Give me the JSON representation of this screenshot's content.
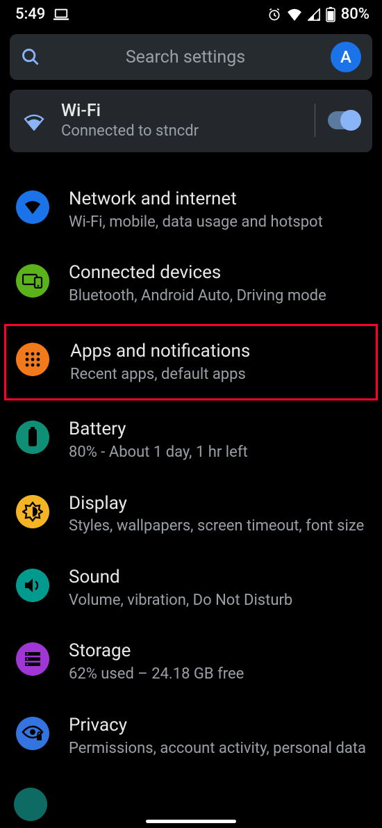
{
  "status": {
    "time": "5:49",
    "battery_pct": "80%"
  },
  "search": {
    "placeholder": "Search settings",
    "avatar_initial": "A"
  },
  "wifi_card": {
    "title": "Wi-Fi",
    "subtitle": "Connected to stncdr",
    "enabled": true
  },
  "items": [
    {
      "title": "Network and internet",
      "subtitle": "Wi-Fi, mobile, data usage and hotspot",
      "icon": "wifi-icon",
      "color": "c-blue"
    },
    {
      "title": "Connected devices",
      "subtitle": "Bluetooth, Android Auto, Driving mode",
      "icon": "devices-icon",
      "color": "c-green"
    },
    {
      "title": "Apps and notifications",
      "subtitle": "Recent apps, default apps",
      "icon": "apps-icon",
      "color": "c-orange",
      "highlight": true
    },
    {
      "title": "Battery",
      "subtitle": "80% - About 1 day, 1 hr left",
      "icon": "battery-icon",
      "color": "c-teal"
    },
    {
      "title": "Display",
      "subtitle": "Styles, wallpapers, screen timeout, font size",
      "icon": "display-icon",
      "color": "c-yellow"
    },
    {
      "title": "Sound",
      "subtitle": "Volume, vibration, Do Not Disturb",
      "icon": "sound-icon",
      "color": "c-teal2"
    },
    {
      "title": "Storage",
      "subtitle": "62% used – 24.18 GB free",
      "icon": "storage-icon",
      "color": "c-purple"
    },
    {
      "title": "Privacy",
      "subtitle": "Permissions, account activity, personal data",
      "icon": "privacy-icon",
      "color": "c-blue2"
    }
  ]
}
